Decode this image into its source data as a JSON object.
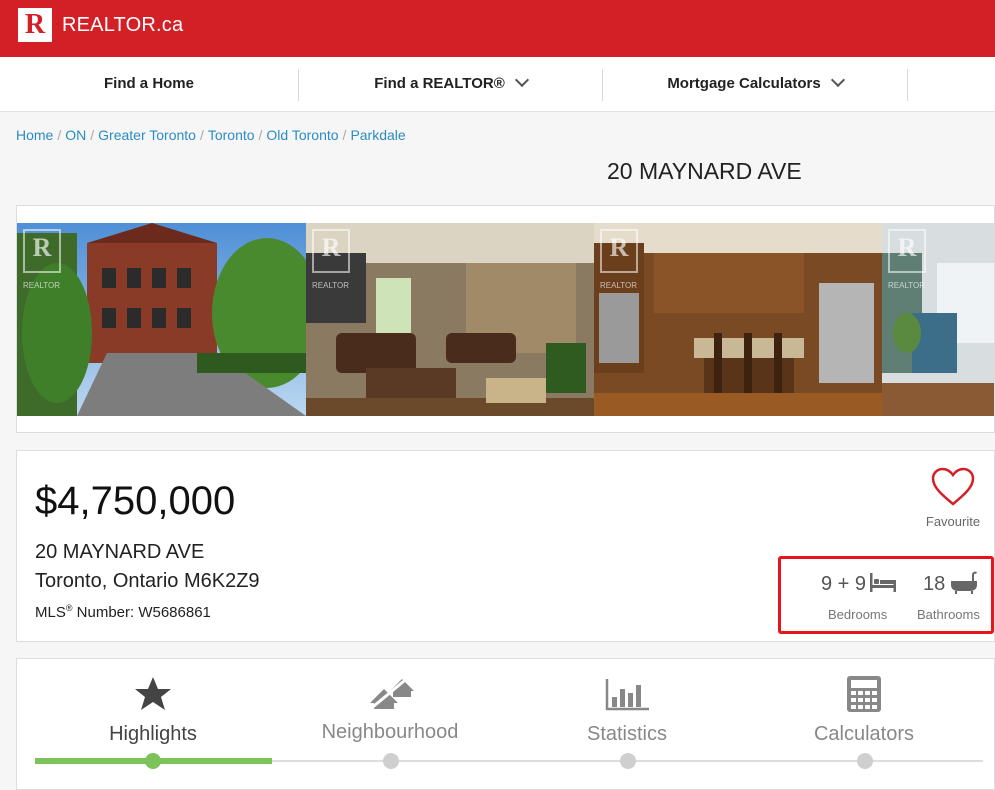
{
  "brand": {
    "logo_letter": "R",
    "name": "REALTOR.ca"
  },
  "nav": {
    "find_home": "Find a Home",
    "find_realtor": "Find a REALTOR®",
    "mortgage": "Mortgage Calculators"
  },
  "breadcrumb": [
    "Home",
    "ON",
    "Greater Toronto",
    "Toronto",
    "Old Toronto",
    "Parkdale"
  ],
  "listing": {
    "title": "20 MAYNARD AVE",
    "price": "$4,750,000",
    "street": "20 MAYNARD AVE",
    "city_line": "Toronto, Ontario M6K2Z9",
    "mls_prefix": "MLS",
    "mls_sup": "®",
    "mls_rest": " Number: W5686861",
    "bedrooms": "9 + 9",
    "bedrooms_label": "Bedrooms",
    "bathrooms": "18",
    "bathrooms_label": "Bathrooms",
    "favourite_label": "Favourite"
  },
  "photo_watermark": {
    "letter": "R",
    "text": "REALTOR"
  },
  "tabs": [
    {
      "label": "Highlights",
      "icon": "star-icon",
      "active": true
    },
    {
      "label": "Neighbourhood",
      "icon": "neighbourhood-icon",
      "active": false
    },
    {
      "label": "Statistics",
      "icon": "bar-chart-icon",
      "active": false
    },
    {
      "label": "Calculators",
      "icon": "calculator-icon",
      "active": false
    }
  ],
  "colors": {
    "brand_red": "#d32027",
    "link_blue": "#2b8cc4",
    "active_green": "#7cc35a",
    "highlight_red": "#e8141b"
  }
}
